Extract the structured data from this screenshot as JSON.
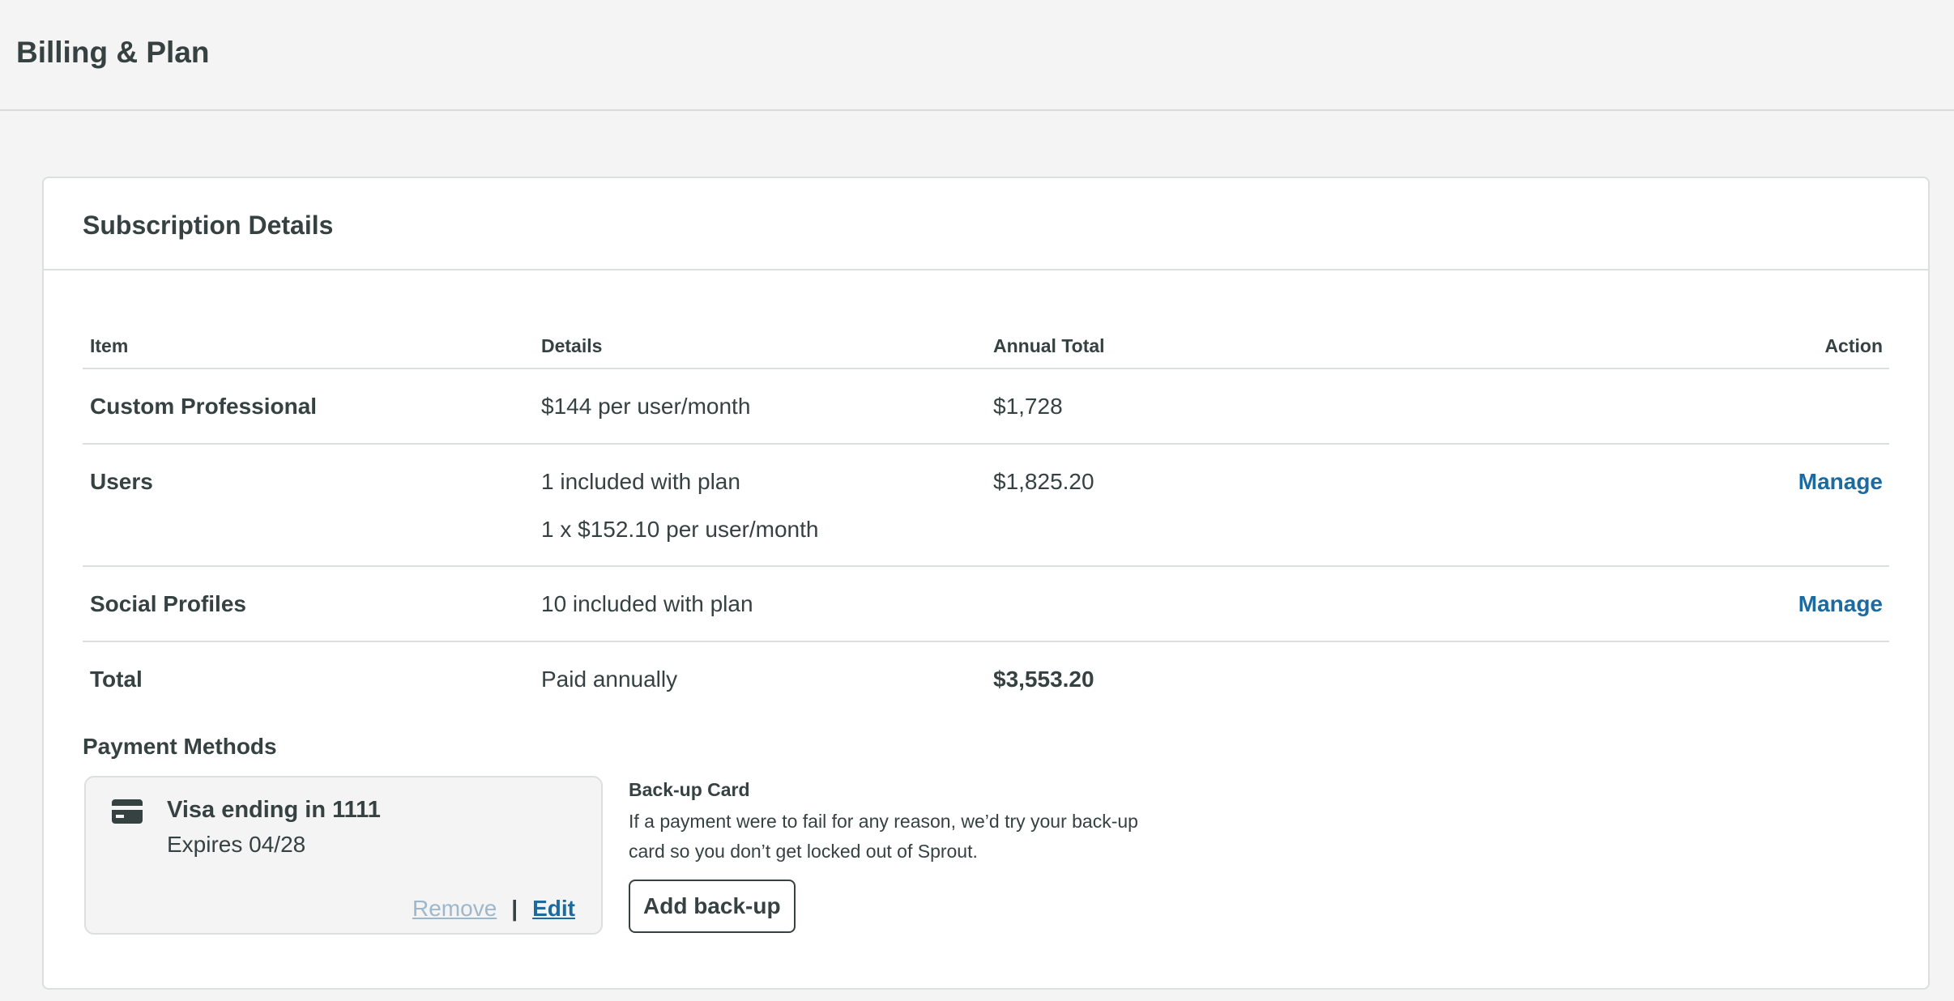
{
  "header": {
    "title": "Billing & Plan"
  },
  "subscription": {
    "title": "Subscription Details",
    "columns": [
      "Item",
      "Details",
      "Annual Total",
      "Action"
    ],
    "rows": [
      {
        "item": "Custom Professional",
        "details": "$144 per user/month",
        "details2": "",
        "total": "$1,728",
        "action": ""
      },
      {
        "item": "Users",
        "details": "1 included with plan",
        "details2": "1 x $152.10 per user/month",
        "total": "$1,825.20",
        "action": "Manage"
      },
      {
        "item": "Social Profiles",
        "details": "10 included with plan",
        "details2": "",
        "total": "",
        "action": "Manage"
      },
      {
        "item": "Total",
        "details": "Paid annually",
        "details2": "",
        "total": "$3,553.20",
        "action": ""
      }
    ]
  },
  "payment": {
    "title": "Payment Methods",
    "card": {
      "icon": "credit-card-icon",
      "name": "Visa ending in 1111",
      "expires": "Expires 04/28",
      "remove_label": "Remove",
      "separator": "|",
      "edit_label": "Edit"
    },
    "backup": {
      "title": "Back-up Card",
      "description": "If a payment were to fail for any reason, we’d try your back-up card so you don’t get locked out of Sprout.",
      "button_label": "Add back-up"
    }
  },
  "colors": {
    "link": "#1b6aa0",
    "link_disabled": "#9db7cc",
    "text": "#364141",
    "border": "#dcdfdf",
    "background": "#f4f4f4"
  }
}
